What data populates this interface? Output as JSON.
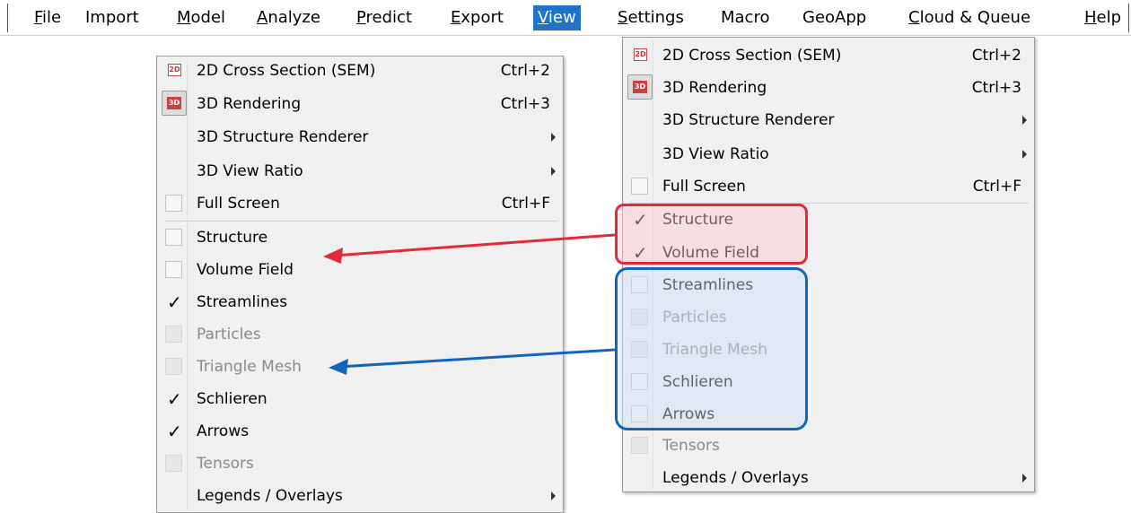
{
  "menubar": {
    "items": [
      {
        "text": "File",
        "ul": "F",
        "rest": "ile",
        "active": false
      },
      {
        "text": "Import",
        "ul": "",
        "rest": "Import",
        "active": false
      },
      {
        "text": "Model",
        "ul": "M",
        "rest": "odel",
        "active": false
      },
      {
        "text": "Analyze",
        "ul": "A",
        "rest": "nalyze",
        "active": false
      },
      {
        "text": "Predict",
        "ul": "P",
        "rest": "redict",
        "active": false
      },
      {
        "text": "Export",
        "ul": "E",
        "rest": "xport",
        "active": false
      },
      {
        "text": "View",
        "ul": "V",
        "rest": "iew",
        "active": true
      },
      {
        "text": "Settings",
        "ul": "S",
        "rest": "ettings",
        "active": false
      },
      {
        "text": "Macro",
        "ul": "",
        "rest": "Macro",
        "active": false
      },
      {
        "text": "GeoApp",
        "ul": "",
        "rest": "GeoApp",
        "active": false
      },
      {
        "text": "Cloud & Queue",
        "ul": "C",
        "rest": "loud & Queue",
        "active": false
      },
      {
        "text": "Help",
        "ul": "H",
        "rest": "elp",
        "active": false
      }
    ]
  },
  "menu_before": {
    "items": [
      {
        "label": "2D Cross Section (SEM)",
        "shortcut": "Ctrl+2",
        "icon": "2d-icon"
      },
      {
        "label": "3D Rendering",
        "shortcut": "Ctrl+3",
        "icon": "3d-icon"
      },
      {
        "label": "3D Structure Renderer",
        "submenu": true
      },
      {
        "label": "3D View Ratio",
        "submenu": true
      },
      {
        "label": "Full Screen",
        "shortcut": "Ctrl+F",
        "checkbox": true,
        "checked": false
      },
      {
        "label": "Structure",
        "checkbox": true,
        "checked": false
      },
      {
        "label": "Volume Field",
        "checkbox": true,
        "checked": false
      },
      {
        "label": "Streamlines",
        "checkbox": true,
        "checked": true
      },
      {
        "label": "Particles",
        "checkbox": true,
        "checked": false,
        "disabled": true
      },
      {
        "label": "Triangle Mesh",
        "checkbox": true,
        "checked": false,
        "disabled": true
      },
      {
        "label": "Schlieren",
        "checkbox": true,
        "checked": true
      },
      {
        "label": "Arrows",
        "checkbox": true,
        "checked": true
      },
      {
        "label": "Tensors",
        "checkbox": true,
        "checked": false,
        "disabled": true
      },
      {
        "label": "Legends / Overlays",
        "submenu": true
      }
    ]
  },
  "menu_after": {
    "items": [
      {
        "label": "2D Cross Section (SEM)",
        "shortcut": "Ctrl+2",
        "icon": "2d-icon"
      },
      {
        "label": "3D Rendering",
        "shortcut": "Ctrl+3",
        "icon": "3d-icon"
      },
      {
        "label": "3D Structure Renderer",
        "submenu": true
      },
      {
        "label": "3D View Ratio",
        "submenu": true
      },
      {
        "label": "Full Screen",
        "shortcut": "Ctrl+F",
        "checkbox": true,
        "checked": false
      },
      {
        "label": "Structure",
        "checkbox": true,
        "checked": true
      },
      {
        "label": "Volume Field",
        "checkbox": true,
        "checked": true
      },
      {
        "label": "Streamlines",
        "checkbox": true,
        "checked": false
      },
      {
        "label": "Particles",
        "checkbox": true,
        "checked": false,
        "disabled": true
      },
      {
        "label": "Triangle Mesh",
        "checkbox": true,
        "checked": false,
        "disabled": true
      },
      {
        "label": "Schlieren",
        "checkbox": true,
        "checked": false
      },
      {
        "label": "Arrows",
        "checkbox": true,
        "checked": false
      },
      {
        "label": "Tensors",
        "checkbox": true,
        "checked": false,
        "disabled": true
      },
      {
        "label": "Legends / Overlays",
        "submenu": true
      }
    ]
  },
  "icons": {
    "2d_text": "2D",
    "3d_text": "3D",
    "check_glyph": "✓"
  },
  "colors": {
    "active_menu": "#1f73c8",
    "highlight_red": "#e5283a",
    "highlight_blue": "#1166bb"
  }
}
